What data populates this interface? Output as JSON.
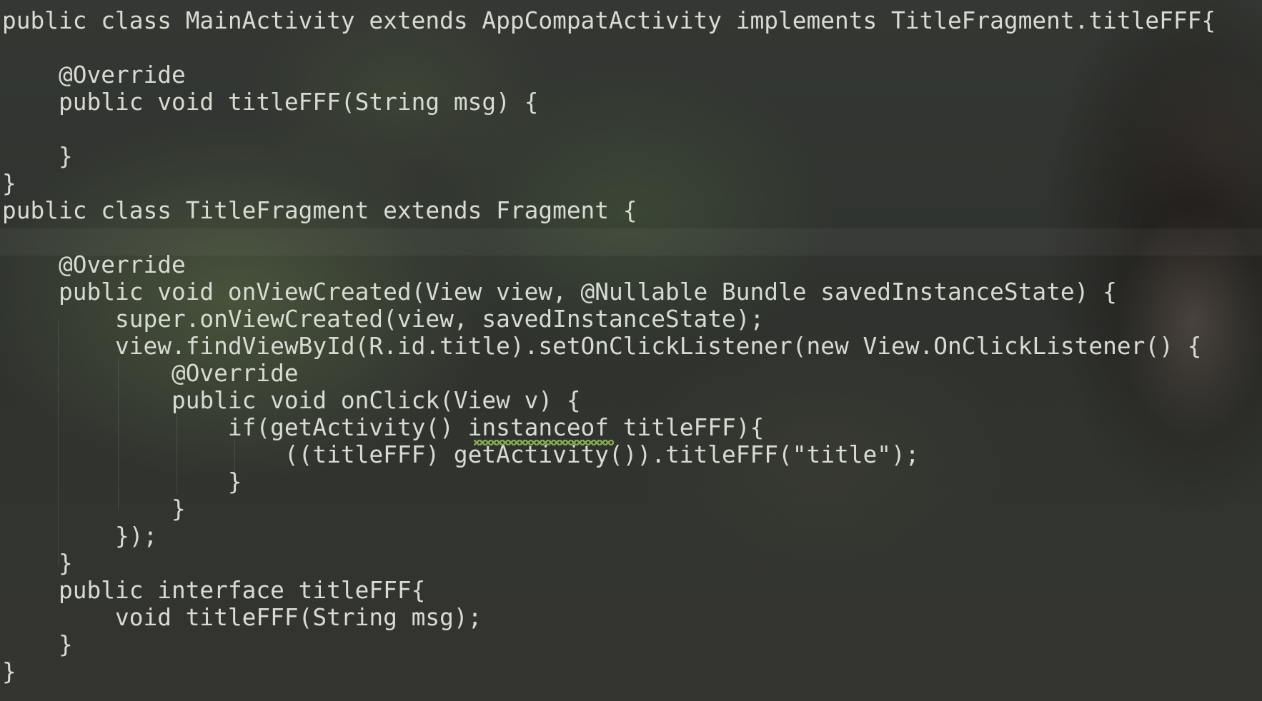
{
  "editor": {
    "theme_colors": {
      "code_text": "#d7dbd2",
      "background": "#2f3130",
      "highlight": "rgba(255,255,255,0.045)"
    },
    "code_lines": [
      "public class MainActivity extends AppCompatActivity implements TitleFragment.titleFFF{",
      "",
      "    @Override",
      "    public void titleFFF(String msg) {",
      "",
      "    }",
      "}",
      "public class TitleFragment extends Fragment {",
      "",
      "    @Override",
      "    public void onViewCreated(View view, @Nullable Bundle savedInstanceState) {",
      "        super.onViewCreated(view, savedInstanceState);",
      "        view.findViewById(R.id.title).setOnClickListener(new View.OnClickListener() {",
      "            @Override",
      "            public void onClick(View v) {",
      "                if(getActivity() instanceof titleFFF){",
      "                    ((titleFFF) getActivity()).titleFFF(\"title\");",
      "                }",
      "            }",
      "        });",
      "    }",
      "    public interface titleFFF{",
      "        void titleFFF(String msg);",
      "    }",
      "}"
    ]
  }
}
